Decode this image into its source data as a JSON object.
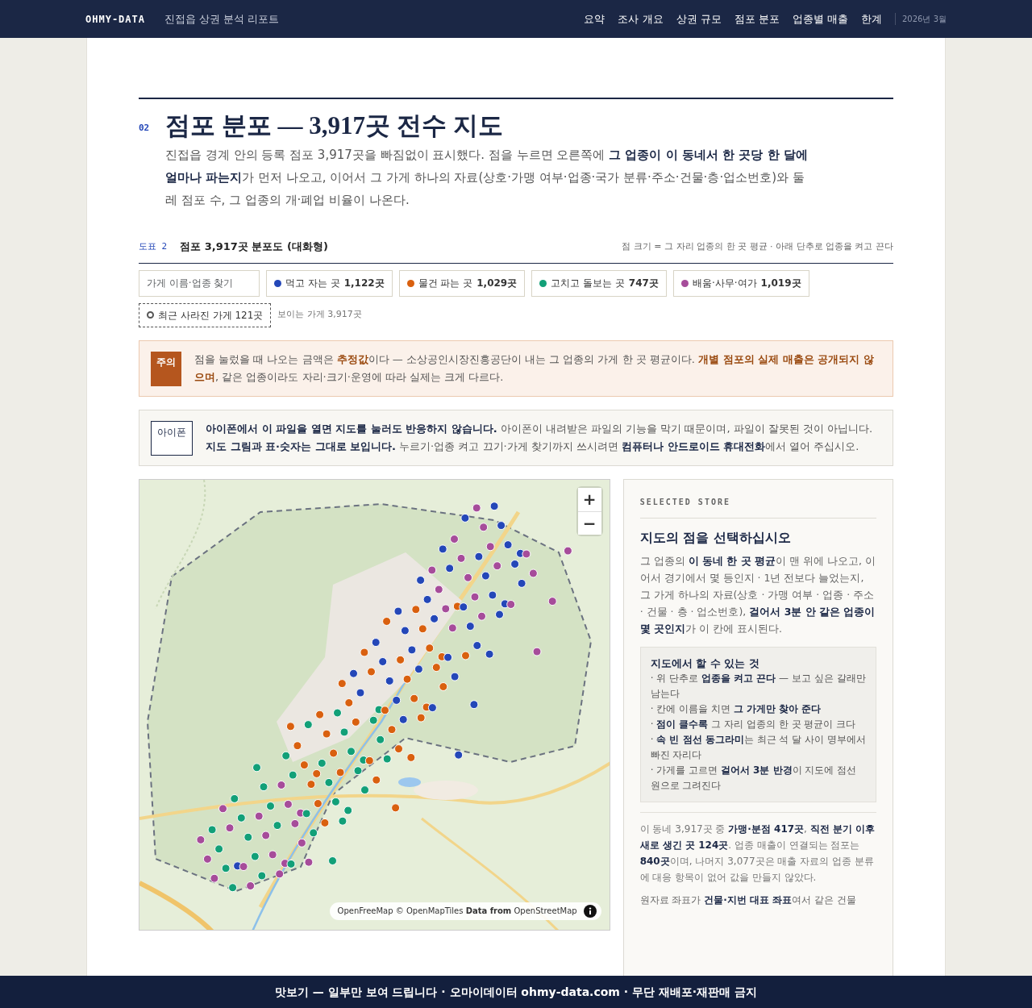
{
  "nav": {
    "brand": "OHMY-DATA",
    "subtitle": "진접읍 상권 분석 리포트",
    "links": [
      "요약",
      "조사 개요",
      "상권 규모",
      "점포 분포",
      "업종별 매출",
      "한계"
    ],
    "date": "2026년 3월"
  },
  "section": {
    "number": "02",
    "title": "점포 분포 — 3,917곳 전수 지도",
    "intro": "진접읍 경계 안의 등록 점포 3,917곳을 빠짐없이 표시했다. 점을 누르면 오른쪽에 **그 업종이 이 동네서 한 곳당 한 달에 얼마나 파는지**가 먼저 나오고, 이어서 그 가게 하나의 자료(상호·가맹 여부·업종·국가 분류·주소·건물·층·업소번호)와 둘레 점포 수, 그 업종의 개·폐업 비율이 나온다."
  },
  "figure": {
    "label": "도표 2",
    "title": "점포 3,917곳 분포도 (대화형)",
    "note": "점 크기 = 그 자리 업종의 한 곳 평균 · 아래 단추로 업종을 켜고 끈다"
  },
  "search": {
    "placeholder": "가게 이름·업종 찾기"
  },
  "filters": [
    {
      "label": "먹고 자는 곳",
      "count": "1,122곳",
      "color": "#2447b8",
      "on": true
    },
    {
      "label": "물건 파는 곳",
      "count": "1,029곳",
      "color": "#d9600f",
      "on": true
    },
    {
      "label": "고치고 돌보는 곳",
      "count": "747곳",
      "color": "#12a078",
      "on": true
    },
    {
      "label": "배움·사무·여가",
      "count": "1,019곳",
      "color": "#a64c9a",
      "on": true
    }
  ],
  "closed_filter": {
    "label": "최근 사라진 가게 121곳",
    "on": false
  },
  "visible_count": "보이는 가게 3,917곳",
  "notices": [
    {
      "kind": "caution",
      "tag": "주의",
      "text": "점을 눌렀을 때 나오는 금액은 **추정값**이다 — 소상공인시장진흥공단이 내는 그 업종의 가게 한 곳 평균이다. **개별 점포의 실제 매출은 공개되지 않으며**, 같은 업종이라도 자리·크기·운영에 따라 실제는 크게 다르다."
    },
    {
      "kind": "device",
      "tag": "아이폰",
      "text": "**아이폰에서 이 파일을 열면 지도를 눌러도 반응하지 않습니다.** 아이폰이 내려받은 파일의 기능을 막기 때문이며, 파일이 잘못된 것이 아닙니다. **지도 그림과 표·숫자는 그대로 보입니다.** 누르기·업종 켜고 끄기·가게 찾기까지 쓰시려면 **컴퓨터나 안드로이드 휴대전화**에서 열어 주십시오."
    }
  ],
  "map": {
    "zoom_in": "+",
    "zoom_out": "−",
    "attribution": "OpenFreeMap © OpenMapTiles **Data from** OpenStreetMap"
  },
  "panel": {
    "eyebrow": "SELECTED STORE",
    "heading": "지도의 점을 선택하십시오",
    "body": "그 업종의 **이 동네 한 곳 평균**이 맨 위에 나오고, 이어서 경기에서 몇 등인지 · 1년 전보다 늘었는지, 그 가게 하나의 자료(상호 · 가맹 여부 · 업종 · 주소 · 건물 · 층 · 업소번호), **걸어서 3분 안 같은 업종이 몇 곳인지**가 이 칸에 표시된다.",
    "help": {
      "title": "지도에서 할 수 있는 것",
      "items": [
        "· 위 단추로 **업종을 켜고 끈다** — 보고 싶은 갈래만 남는다",
        "· 칸에 이름을 치면 **그 가게만 찾아 준다**",
        "· **점이 클수록** 그 자리 업종의 한 곳 평균이 크다",
        "· **속 빈 점선 동그라미**는 최근 석 달 사이 명부에서 빠진 자리다",
        "· 가게를 고르면 **걸어서 3분 반경**이 지도에 점선 원으로 그려진다"
      ]
    },
    "stats": "이 동네 3,917곳 중 **가맹·분점 417곳**, **직전 분기 이후 새로 생긴 곳 124곳**. 업종 매출이 연결되는 점포는 **840곳**이며, 나머지 3,077곳은 매출 자료의 업종 분류에 대응 항목이 없어 값을 만들지 않았다.",
    "note": "원자료 좌표가 **건물·지번 대표 좌표**여서 같은 건물"
  },
  "footer": "맛보기 — 일부만 보여 드립니다 · 오마이데이터 ohmy-data.com · 무단 재배포·재판매 금지"
}
